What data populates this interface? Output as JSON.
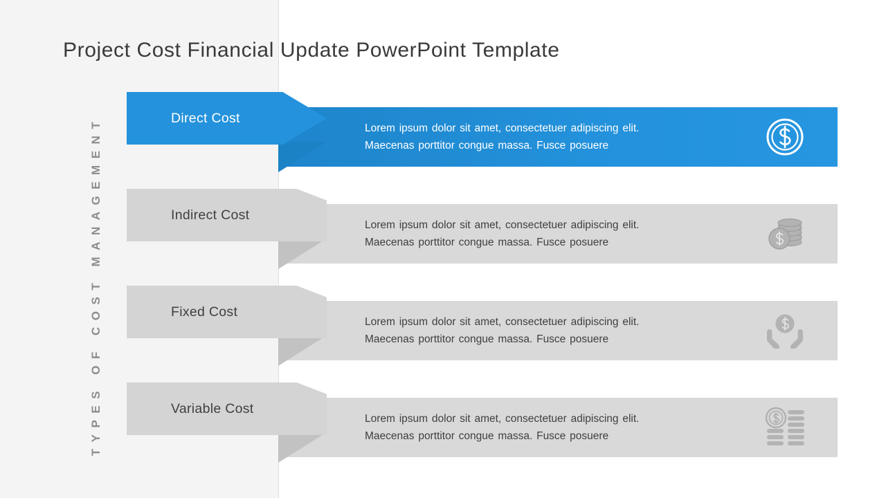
{
  "title": "Project Cost Financial Update PowerPoint Template",
  "side_label": "TYPES OF COST MANAGEMENT",
  "colors": {
    "accent_blue": "#2492dc",
    "accent_blue_dark": "#1d85cb",
    "grey_tab": "#d4d4d4",
    "grey_body": "#d9d9d9",
    "panel_bg": "#f4f4f4",
    "title_text": "#3a3a3a",
    "side_label_text": "#8c8c8c"
  },
  "rows": [
    {
      "label": "Direct Cost",
      "desc_line1": "Lorem ipsum dolor sit amet, consectetuer  adipiscing elit.",
      "desc_line2": "Maecenas  porttitor  congue  massa.  Fusce  posuere",
      "icon": "dollar-coin-icon",
      "theme": "blue"
    },
    {
      "label": "Indirect Cost",
      "desc_line1": "Lorem ipsum dolor sit amet, consectetuer  adipiscing elit.",
      "desc_line2": "Maecenas  porttitor  congue  massa.  Fusce  posuere",
      "icon": "coin-stack-icon",
      "theme": "grey"
    },
    {
      "label": "Fixed Cost",
      "desc_line1": "Lorem ipsum dolor sit amet, consectetuer  adipiscing elit.",
      "desc_line2": "Maecenas  porttitor  congue  massa.  Fusce  posuere",
      "icon": "hands-holding-coin-icon",
      "theme": "grey"
    },
    {
      "label": "Variable Cost",
      "desc_line1": "Lorem ipsum dolor sit amet, consectetuer  adipiscing elit.",
      "desc_line2": "Maecenas  porttitor  congue  massa.  Fusce  posuere",
      "icon": "money-stacks-icon",
      "theme": "grey"
    }
  ]
}
